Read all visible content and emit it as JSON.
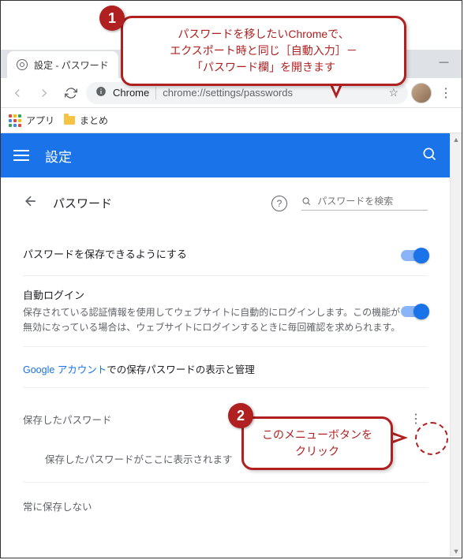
{
  "browser": {
    "tab_title": "設定 - パスワード",
    "omnibox_host": "Chrome",
    "omnibox_path": "chrome://settings/passwords"
  },
  "bookmarks": {
    "apps_label": "アプリ",
    "folder_label": "まとめ"
  },
  "settings": {
    "appbar_title": "設定",
    "subheader_title": "パスワード",
    "search_placeholder": "パスワードを検索",
    "save_passwords_label": "パスワードを保存できるようにする",
    "autologin_title": "自動ログイン",
    "autologin_desc": "保存されている認証情報を使用してウェブサイトに自動的にログインします。この機能が無効になっている場合は、ウェブサイトにログインするときに毎回確認を求められます。",
    "google_link": "Google アカウント",
    "google_link_suffix": "での保存パスワードの表示と管理",
    "saved_passwords_label": "保存したパスワード",
    "saved_passwords_empty": "保存したパスワードがここに表示されます",
    "never_save_label": "常に保存しない"
  },
  "annotations": {
    "num1": "1",
    "num2": "2",
    "callout1_line1": "パスワードを移したいChromeで、",
    "callout1_line2": "エクスポート時と同じ［自動入力］－",
    "callout1_line3": "「パスワード欄」を開きます",
    "callout2_line1": "このメニューボタンを",
    "callout2_line2": "クリック"
  }
}
